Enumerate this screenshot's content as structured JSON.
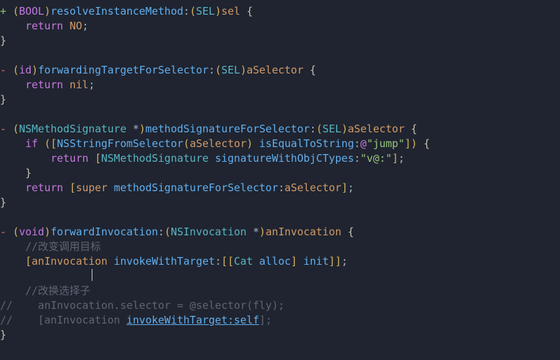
{
  "language": "objective-c",
  "diff": true,
  "code_lines": [
    {
      "gutter": "+",
      "type": "add"
    },
    {
      "gutter": "-",
      "type": "del"
    },
    {
      "gutter": "//",
      "type": "comment"
    }
  ],
  "tokens": {
    "g_add": "+ ",
    "g_del": "- ",
    "g_cmt": "//",
    "paren_o": "(",
    "paren_c": ")",
    "brack_o": "[",
    "brack_c": "]",
    "brace_o": "{",
    "brace_c": "}",
    "star": " *",
    "colon": ":",
    "semi": ";",
    "dot": ".",
    "eq": " = ",
    "sp": " ",
    "at": "@",
    "atsel": "@selector",
    "return": "return",
    "if": "if",
    "super": "super",
    "BOOL": "BOOL",
    "id": "id",
    "void": "void",
    "NO": "NO",
    "nil": "nil",
    "SEL": "SEL",
    "NSMethodSignature": "NSMethodSignature",
    "NSInvocation": "NSInvocation",
    "NSStringFromSelector": "NSStringFromSelector",
    "Cat": "Cat",
    "resolveInstanceMethod": "resolveInstanceMethod",
    "forwardingTargetForSelector": "forwardingTargetForSelector",
    "methodSignatureForSelector": "methodSignatureForSelector",
    "signatureWithObjCTypes": "signatureWithObjCTypes",
    "isEqualToString": "isEqualToString",
    "forwardInvocation": "forwardInvocation",
    "invokeWithTarget": "invokeWithTarget",
    "invokeWithTarget_self": "invokeWithTarget:self",
    "alloc": "alloc",
    "init": "init",
    "selector": "selector",
    "fly": "fly",
    "sel": "sel",
    "aSelector": "aSelector",
    "anInvocation": "anInvocation",
    "str_jump": "\"jump\"",
    "str_types": "\"v@:\"",
    "cmt_target": "//改变调用目标",
    "cmt_sel": "//改换选择子",
    "cmt_line1": "    anInvocation.selector = @selector(fly);",
    "cmt_line2": "    [anInvocation ",
    "indent1": "    ",
    "indent2": "        "
  }
}
